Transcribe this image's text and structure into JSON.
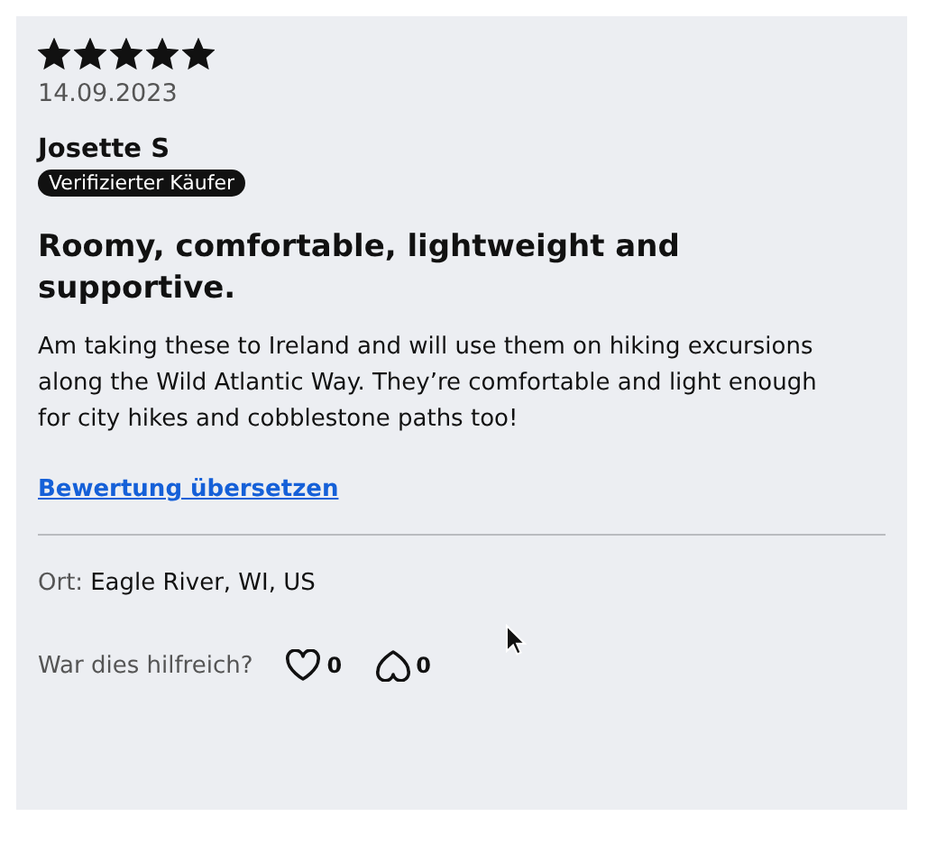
{
  "review": {
    "stars": 5,
    "date": "14.09.2023",
    "author": "Josette S",
    "badge": "Verifizierter Käufer",
    "title": "Roomy, comfortable, lightweight and supportive.",
    "body": "Am taking these to Ireland and will use them on hiking excursions along the Wild Atlantic Way. They’re comfortable and light enough for city hikes and cobblestone paths too!",
    "translate_link": "Bewertung übersetzen",
    "location_label": "Ort:",
    "location": "Eagle River, WI, US",
    "helpful_prompt": "War dies hilfreich?",
    "votes": [
      {
        "kind": "up",
        "count": "0"
      },
      {
        "kind": "down",
        "count": "0"
      }
    ]
  }
}
